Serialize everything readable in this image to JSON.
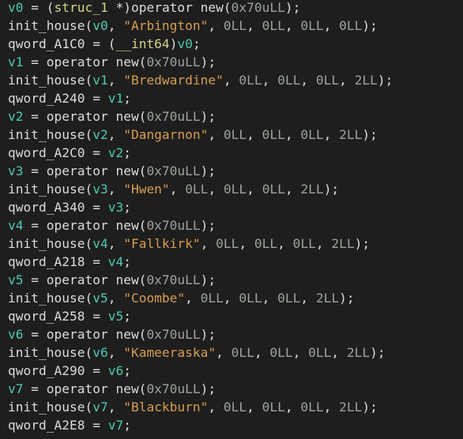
{
  "colors": {
    "background": "#1e1e1e",
    "plain_text": "#dcdcdc",
    "variable": "#4ec9b0",
    "string_literal": "#d69d51",
    "number_literal": "#9aa59a",
    "type_keyword": "#d4d48a"
  },
  "lines": [
    [
      {
        "t": "v0",
        "k": "var"
      },
      {
        "t": " = (",
        "k": "plain"
      },
      {
        "t": "struc_1",
        "k": "type"
      },
      {
        "t": " *)operator new(",
        "k": "plain"
      },
      {
        "t": "0x70uLL",
        "k": "num"
      },
      {
        "t": ");",
        "k": "plain"
      }
    ],
    [
      {
        "t": "init_house(",
        "k": "plain"
      },
      {
        "t": "v0",
        "k": "var"
      },
      {
        "t": ", ",
        "k": "plain"
      },
      {
        "t": "\"Arbington\"",
        "k": "string"
      },
      {
        "t": ", ",
        "k": "plain"
      },
      {
        "t": "0LL",
        "k": "num"
      },
      {
        "t": ", ",
        "k": "plain"
      },
      {
        "t": "0LL",
        "k": "num"
      },
      {
        "t": ", ",
        "k": "plain"
      },
      {
        "t": "0LL",
        "k": "num"
      },
      {
        "t": ", ",
        "k": "plain"
      },
      {
        "t": "0LL",
        "k": "num"
      },
      {
        "t": ");",
        "k": "plain"
      }
    ],
    [
      {
        "t": "qword_A1C0 = (",
        "k": "plain"
      },
      {
        "t": "__int64",
        "k": "type"
      },
      {
        "t": ")",
        "k": "plain"
      },
      {
        "t": "v0",
        "k": "var"
      },
      {
        "t": ";",
        "k": "plain"
      }
    ],
    [
      {
        "t": "v1",
        "k": "var"
      },
      {
        "t": " = operator new(",
        "k": "plain"
      },
      {
        "t": "0x70uLL",
        "k": "num"
      },
      {
        "t": ");",
        "k": "plain"
      }
    ],
    [
      {
        "t": "init_house(",
        "k": "plain"
      },
      {
        "t": "v1",
        "k": "var"
      },
      {
        "t": ", ",
        "k": "plain"
      },
      {
        "t": "\"Bredwardine\"",
        "k": "string"
      },
      {
        "t": ", ",
        "k": "plain"
      },
      {
        "t": "0LL",
        "k": "num"
      },
      {
        "t": ", ",
        "k": "plain"
      },
      {
        "t": "0LL",
        "k": "num"
      },
      {
        "t": ", ",
        "k": "plain"
      },
      {
        "t": "0LL",
        "k": "num"
      },
      {
        "t": ", ",
        "k": "plain"
      },
      {
        "t": "2LL",
        "k": "num"
      },
      {
        "t": ");",
        "k": "plain"
      }
    ],
    [
      {
        "t": "qword_A240 = ",
        "k": "plain"
      },
      {
        "t": "v1",
        "k": "var"
      },
      {
        "t": ";",
        "k": "plain"
      }
    ],
    [
      {
        "t": "v2",
        "k": "var"
      },
      {
        "t": " = operator new(",
        "k": "plain"
      },
      {
        "t": "0x70uLL",
        "k": "num"
      },
      {
        "t": ");",
        "k": "plain"
      }
    ],
    [
      {
        "t": "init_house(",
        "k": "plain"
      },
      {
        "t": "v2",
        "k": "var"
      },
      {
        "t": ", ",
        "k": "plain"
      },
      {
        "t": "\"Dangarnon\"",
        "k": "string"
      },
      {
        "t": ", ",
        "k": "plain"
      },
      {
        "t": "0LL",
        "k": "num"
      },
      {
        "t": ", ",
        "k": "plain"
      },
      {
        "t": "0LL",
        "k": "num"
      },
      {
        "t": ", ",
        "k": "plain"
      },
      {
        "t": "0LL",
        "k": "num"
      },
      {
        "t": ", ",
        "k": "plain"
      },
      {
        "t": "2LL",
        "k": "num"
      },
      {
        "t": ");",
        "k": "plain"
      }
    ],
    [
      {
        "t": "qword_A2C0 = ",
        "k": "plain"
      },
      {
        "t": "v2",
        "k": "var"
      },
      {
        "t": ";",
        "k": "plain"
      }
    ],
    [
      {
        "t": "v3",
        "k": "var"
      },
      {
        "t": " = operator new(",
        "k": "plain"
      },
      {
        "t": "0x70uLL",
        "k": "num"
      },
      {
        "t": ");",
        "k": "plain"
      }
    ],
    [
      {
        "t": "init_house(",
        "k": "plain"
      },
      {
        "t": "v3",
        "k": "var"
      },
      {
        "t": ", ",
        "k": "plain"
      },
      {
        "t": "\"Hwen\"",
        "k": "string"
      },
      {
        "t": ", ",
        "k": "plain"
      },
      {
        "t": "0LL",
        "k": "num"
      },
      {
        "t": ", ",
        "k": "plain"
      },
      {
        "t": "0LL",
        "k": "num"
      },
      {
        "t": ", ",
        "k": "plain"
      },
      {
        "t": "0LL",
        "k": "num"
      },
      {
        "t": ", ",
        "k": "plain"
      },
      {
        "t": "2LL",
        "k": "num"
      },
      {
        "t": ");",
        "k": "plain"
      }
    ],
    [
      {
        "t": "qword_A340 = ",
        "k": "plain"
      },
      {
        "t": "v3",
        "k": "var"
      },
      {
        "t": ";",
        "k": "plain"
      }
    ],
    [
      {
        "t": "v4",
        "k": "var"
      },
      {
        "t": " = operator new(",
        "k": "plain"
      },
      {
        "t": "0x70uLL",
        "k": "num"
      },
      {
        "t": ");",
        "k": "plain"
      }
    ],
    [
      {
        "t": "init_house(",
        "k": "plain"
      },
      {
        "t": "v4",
        "k": "var"
      },
      {
        "t": ", ",
        "k": "plain"
      },
      {
        "t": "\"Fallkirk\"",
        "k": "string"
      },
      {
        "t": ", ",
        "k": "plain"
      },
      {
        "t": "0LL",
        "k": "num"
      },
      {
        "t": ", ",
        "k": "plain"
      },
      {
        "t": "0LL",
        "k": "num"
      },
      {
        "t": ", ",
        "k": "plain"
      },
      {
        "t": "0LL",
        "k": "num"
      },
      {
        "t": ", ",
        "k": "plain"
      },
      {
        "t": "2LL",
        "k": "num"
      },
      {
        "t": ");",
        "k": "plain"
      }
    ],
    [
      {
        "t": "qword_A218 = ",
        "k": "plain"
      },
      {
        "t": "v4",
        "k": "var"
      },
      {
        "t": ";",
        "k": "plain"
      }
    ],
    [
      {
        "t": "v5",
        "k": "var"
      },
      {
        "t": " = operator new(",
        "k": "plain"
      },
      {
        "t": "0x70uLL",
        "k": "num"
      },
      {
        "t": ");",
        "k": "plain"
      }
    ],
    [
      {
        "t": "init_house(",
        "k": "plain"
      },
      {
        "t": "v5",
        "k": "var"
      },
      {
        "t": ", ",
        "k": "plain"
      },
      {
        "t": "\"Coombe\"",
        "k": "string"
      },
      {
        "t": ", ",
        "k": "plain"
      },
      {
        "t": "0LL",
        "k": "num"
      },
      {
        "t": ", ",
        "k": "plain"
      },
      {
        "t": "0LL",
        "k": "num"
      },
      {
        "t": ", ",
        "k": "plain"
      },
      {
        "t": "0LL",
        "k": "num"
      },
      {
        "t": ", ",
        "k": "plain"
      },
      {
        "t": "2LL",
        "k": "num"
      },
      {
        "t": ");",
        "k": "plain"
      }
    ],
    [
      {
        "t": "qword_A258 = ",
        "k": "plain"
      },
      {
        "t": "v5",
        "k": "var"
      },
      {
        "t": ";",
        "k": "plain"
      }
    ],
    [
      {
        "t": "v6",
        "k": "var"
      },
      {
        "t": " = operator new(",
        "k": "plain"
      },
      {
        "t": "0x70uLL",
        "k": "num"
      },
      {
        "t": ");",
        "k": "plain"
      }
    ],
    [
      {
        "t": "init_house(",
        "k": "plain"
      },
      {
        "t": "v6",
        "k": "var"
      },
      {
        "t": ", ",
        "k": "plain"
      },
      {
        "t": "\"Kameeraska\"",
        "k": "string"
      },
      {
        "t": ", ",
        "k": "plain"
      },
      {
        "t": "0LL",
        "k": "num"
      },
      {
        "t": ", ",
        "k": "plain"
      },
      {
        "t": "0LL",
        "k": "num"
      },
      {
        "t": ", ",
        "k": "plain"
      },
      {
        "t": "0LL",
        "k": "num"
      },
      {
        "t": ", ",
        "k": "plain"
      },
      {
        "t": "2LL",
        "k": "num"
      },
      {
        "t": ");",
        "k": "plain"
      }
    ],
    [
      {
        "t": "qword_A290 = ",
        "k": "plain"
      },
      {
        "t": "v6",
        "k": "var"
      },
      {
        "t": ";",
        "k": "plain"
      }
    ],
    [
      {
        "t": "v7",
        "k": "var"
      },
      {
        "t": " = operator new(",
        "k": "plain"
      },
      {
        "t": "0x70uLL",
        "k": "num"
      },
      {
        "t": ");",
        "k": "plain"
      }
    ],
    [
      {
        "t": "init_house(",
        "k": "plain"
      },
      {
        "t": "v7",
        "k": "var"
      },
      {
        "t": ", ",
        "k": "plain"
      },
      {
        "t": "\"Blackburn\"",
        "k": "string"
      },
      {
        "t": ", ",
        "k": "plain"
      },
      {
        "t": "0LL",
        "k": "num"
      },
      {
        "t": ", ",
        "k": "plain"
      },
      {
        "t": "0LL",
        "k": "num"
      },
      {
        "t": ", ",
        "k": "plain"
      },
      {
        "t": "0LL",
        "k": "num"
      },
      {
        "t": ", ",
        "k": "plain"
      },
      {
        "t": "2LL",
        "k": "num"
      },
      {
        "t": ");",
        "k": "plain"
      }
    ],
    [
      {
        "t": "qword_A2E8 = ",
        "k": "plain"
      },
      {
        "t": "v7",
        "k": "var"
      },
      {
        "t": ";",
        "k": "plain"
      }
    ]
  ]
}
